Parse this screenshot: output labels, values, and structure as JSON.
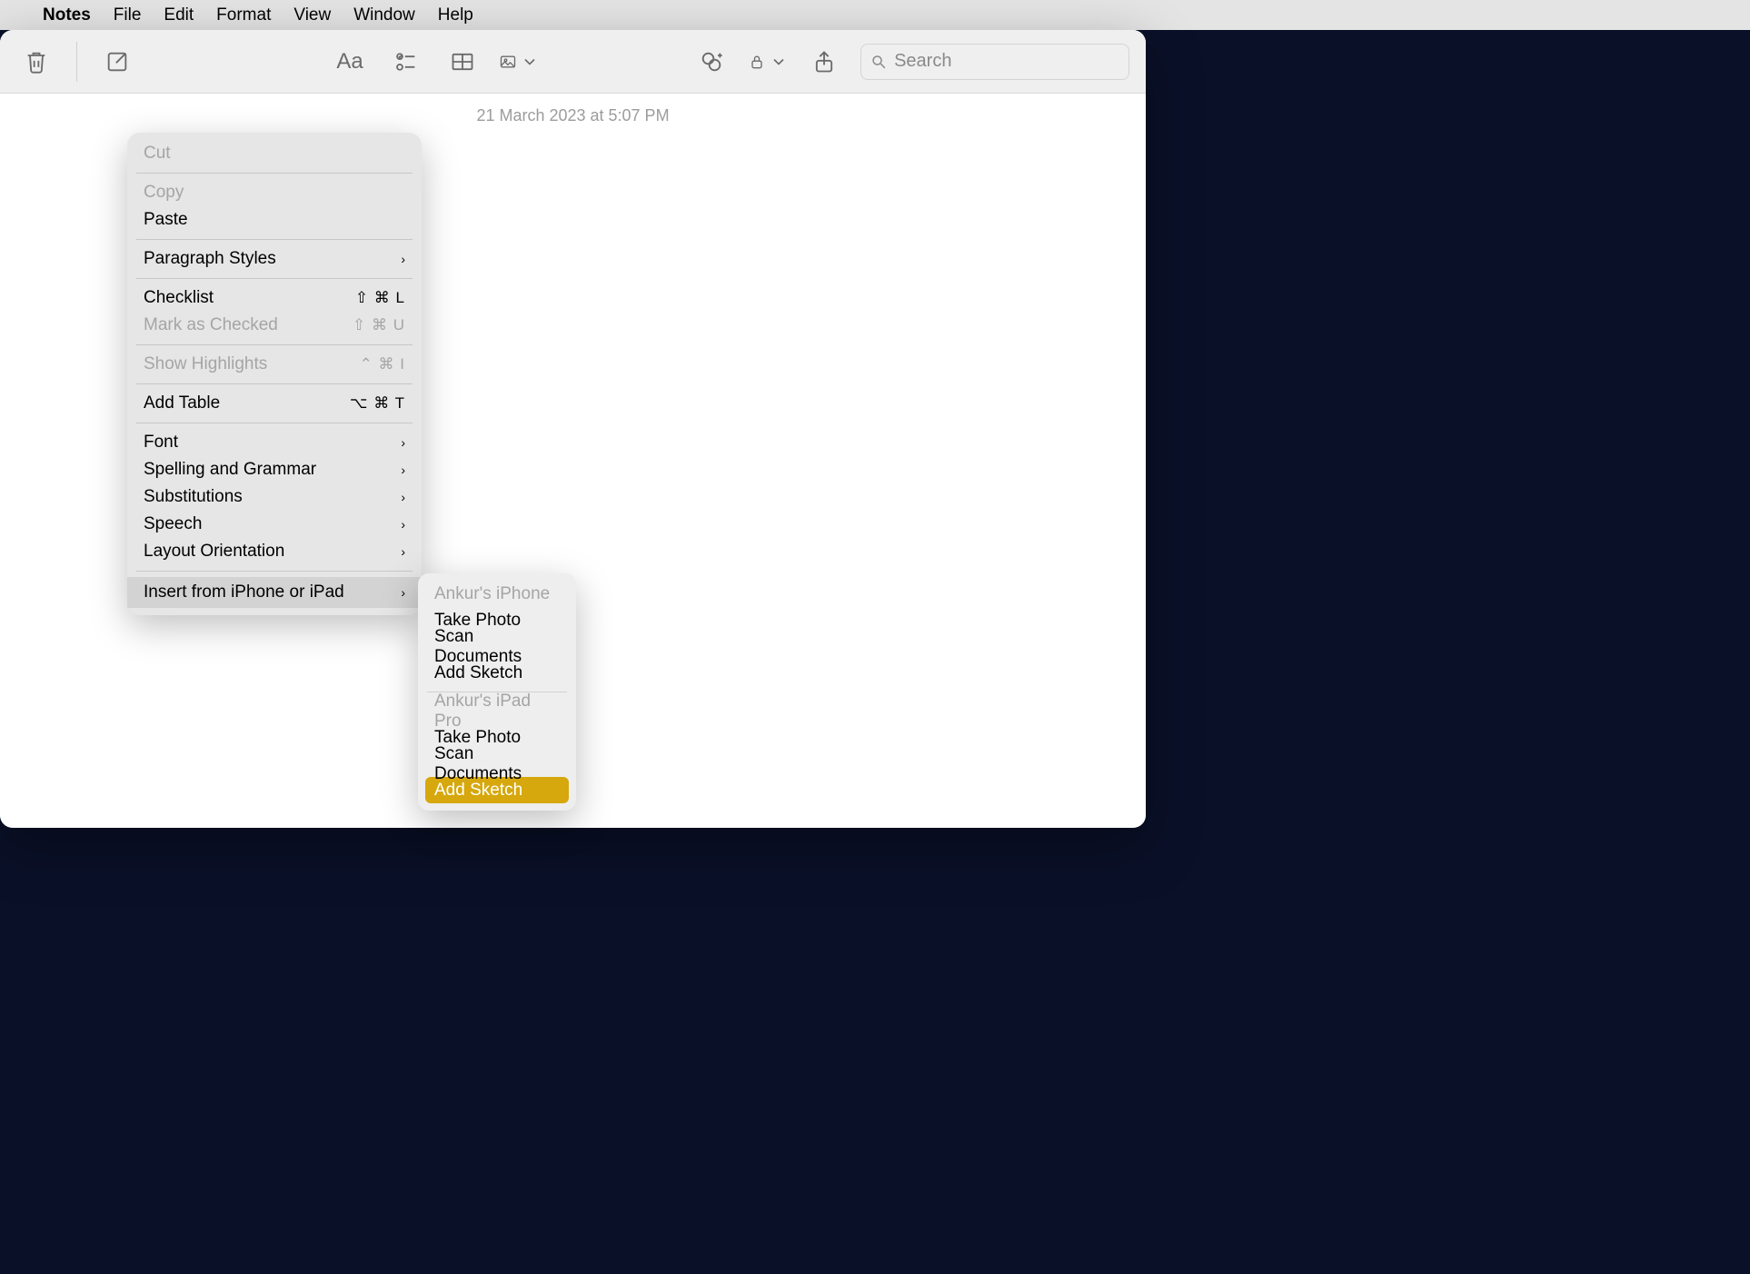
{
  "menubar": {
    "app": "Notes",
    "items": [
      "File",
      "Edit",
      "Format",
      "View",
      "Window",
      "Help"
    ]
  },
  "toolbar": {
    "search_placeholder": "Search"
  },
  "note": {
    "date": "21 March 2023 at 5:07 PM"
  },
  "ctx": {
    "cut": "Cut",
    "copy": "Copy",
    "paste": "Paste",
    "paragraph": "Paragraph Styles",
    "checklist": "Checklist",
    "checklist_sc": "⇧ ⌘ L",
    "mark_checked": "Mark as Checked",
    "mark_checked_sc": "⇧ ⌘ U",
    "show_highlights": "Show Highlights",
    "show_highlights_sc": "⌃ ⌘  I",
    "add_table": "Add Table",
    "add_table_sc": "⌥ ⌘ T",
    "font": "Font",
    "spelling": "Spelling and Grammar",
    "substitutions": "Substitutions",
    "speech": "Speech",
    "layout": "Layout Orientation",
    "insert": "Insert from iPhone or iPad"
  },
  "sub": {
    "dev1": "Ankur's iPhone",
    "take_photo": "Take Photo",
    "scan": "Scan Documents",
    "sketch": "Add Sketch",
    "dev2": "Ankur's iPad Pro"
  }
}
